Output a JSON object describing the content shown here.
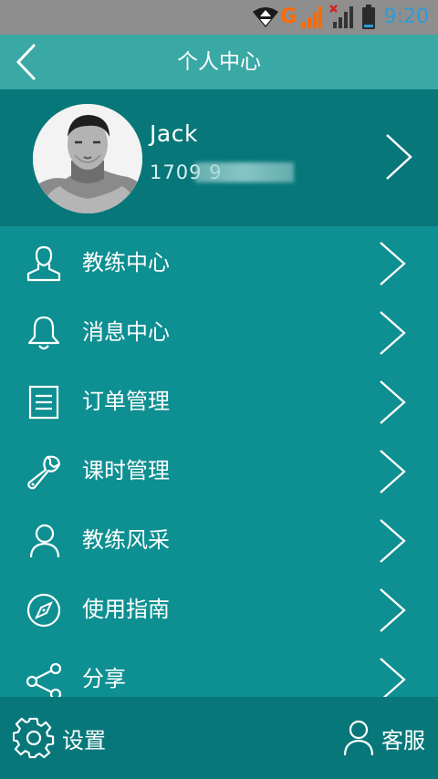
{
  "status_bar": {
    "network_label": "G",
    "time": "9:20",
    "icons": [
      "wifi-icon",
      "signal-icon",
      "no-signal-icon",
      "battery-icon"
    ]
  },
  "header": {
    "title": "个人中心",
    "back_icon": "chevron-left-icon"
  },
  "profile": {
    "name": "Jack",
    "phone": "1709        9"
  },
  "menu": {
    "items": [
      {
        "label": "教练中心",
        "icon": "user-icon"
      },
      {
        "label": "消息中心",
        "icon": "bell-icon"
      },
      {
        "label": "订单管理",
        "icon": "document-icon"
      },
      {
        "label": "课时管理",
        "icon": "wrench-icon"
      },
      {
        "label": "教练风采",
        "icon": "person-icon"
      },
      {
        "label": "使用指南",
        "icon": "compass-icon"
      },
      {
        "label": "分享",
        "icon": "share-icon"
      }
    ]
  },
  "bottom_bar": {
    "settings_label": "设置",
    "service_label": "客服"
  },
  "colors": {
    "status_bar": "#8e8e8e",
    "header": "#3aa8a5",
    "profile": "#08777a",
    "menu": "#0e8f91",
    "time": "#2e9bd6",
    "network": "#ff6a00"
  }
}
